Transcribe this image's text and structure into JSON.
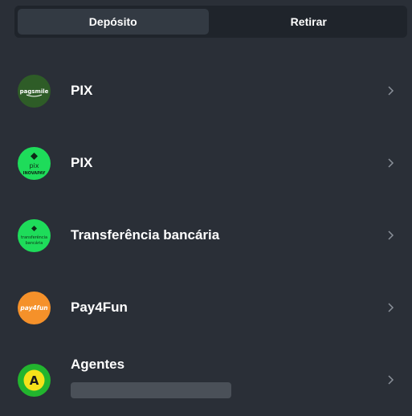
{
  "tabs": [
    {
      "label": "Depósito",
      "active": true
    },
    {
      "label": "Retirar",
      "active": false
    }
  ],
  "methods": [
    {
      "label": "PIX",
      "logo_text": "pagsmile",
      "logo_color": "#2e5c27"
    },
    {
      "label": "PIX",
      "logo_text": "pix",
      "logo_subtext": "INOVAPAY",
      "logo_color": "#1edc5a"
    },
    {
      "label": "Transferência bancária",
      "logo_text": "transferência",
      "logo_subtext": "bancária",
      "logo_color": "#1edc5a"
    },
    {
      "label": "Pay4Fun",
      "logo_text": "pay4fun",
      "logo_color": "#f5912a"
    },
    {
      "label": "Agentes",
      "logo_text": "A",
      "logo_color": "#22b52e"
    }
  ]
}
